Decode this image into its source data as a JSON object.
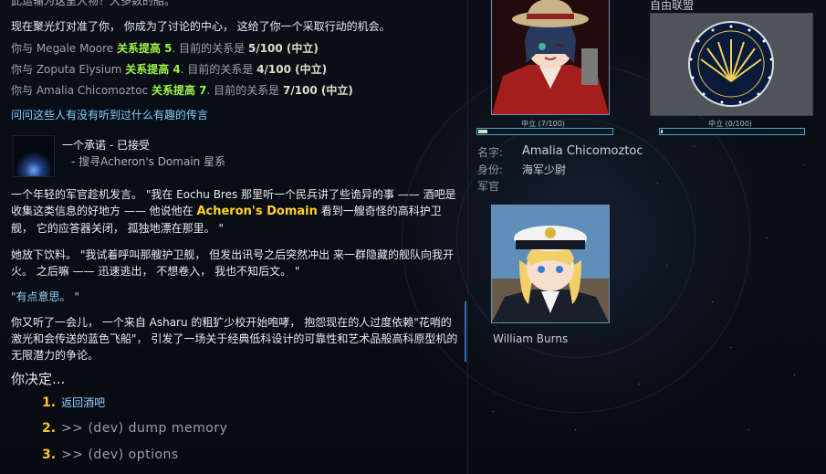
{
  "dialog": {
    "top_cut": "此运输为这里人物？大多数的船。",
    "intro": "现在聚光灯对准了你， 你成为了讨论的中心， 这给了你一个采取行动的机会。",
    "relations": [
      {
        "pre": "你与 ",
        "name": "Megale Moore",
        "boost": "关系提高 5",
        "mid": ". 目前的关系是 ",
        "value": "5/100 (中立)"
      },
      {
        "pre": "你与 ",
        "name": "Zoputa Elysium",
        "boost": "关系提高 4",
        "mid": ". 目前的关系是 ",
        "value": "4/100 (中立)"
      },
      {
        "pre": "你与 ",
        "name": "Amalia Chicomoztoc",
        "boost": "关系提高 7",
        "mid": ". 目前的关系是 ",
        "value": "7/100 (中立)"
      }
    ],
    "ask_link": "问问这些人有没有听到过什么有趣的传言",
    "mission_title": "一个承诺 - 已接受",
    "mission_sub": "- 搜寻Acheron's Domain 星系",
    "para1_a": "一个年轻的军官趁机发言。 \"我在 Eochu Bres 那里听一个民兵讲了些诡异的事 —— 酒吧是收集这类信息的好地方 —— 他说他在 ",
    "para1_gold": "Acheron's Domain",
    "para1_b": " 看到一艘奇怪的高科护卫舰， 它的应答器关闭， 孤独地漂在那里。 \"",
    "para2": "她放下饮料。 \"我试着呼叫那艘护卫舰， 但发出讯号之后突然冲出 来一群隐藏的舰队向我开火。 之后嘛 —— 迅速逃出， 不想卷入， 我也不知后文。 \"",
    "para3": "\"有点意思。 \"",
    "para4": "你又听了一会儿， 一个来自 Asharu 的粗犷少校开始咆哮， 抱怨现在的人过度依赖\"花哨的激光和会传送的蓝色飞船\"， 引发了一场关于经典低科设计的可靠性和艺术品般高科原型机的无限潜力的争论。",
    "decide": "你决定...",
    "options": [
      {
        "n": "1.",
        "t": "返回酒吧"
      },
      {
        "n": "2.",
        "t": ">> (dev) dump memory"
      },
      {
        "n": "3.",
        "t": ">> (dev) options"
      }
    ]
  },
  "side": {
    "faction_name": "自由联盟",
    "rel_person": "中立 (7/100)",
    "rel_faction": "中立 (0/100)",
    "rel_person_fraction": 0.07,
    "rel_faction_fraction": 0.0,
    "info": [
      {
        "label": "名字:",
        "value": "Amalia Chicomoztoc"
      },
      {
        "label": "身份:",
        "value": "海军少尉"
      },
      {
        "label": "军官",
        "value": ""
      }
    ],
    "second_name": "William Burns"
  },
  "colors": {
    "accent_gold": "#ffc41f",
    "relation_green": "#9cf046",
    "link_blue": "#7fd0ff"
  }
}
